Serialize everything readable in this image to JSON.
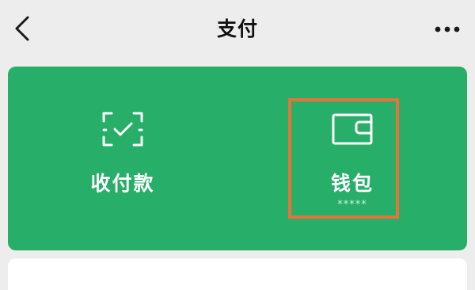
{
  "header": {
    "back_icon": "chevron-left-icon",
    "title": "支付",
    "more_icon": "more-dots-icon"
  },
  "pay_card": {
    "background_color": "#27ae69",
    "items": [
      {
        "label": "收付款",
        "icon": "scan-check-icon"
      },
      {
        "label": "钱包",
        "icon": "wallet-icon",
        "sub": "*****"
      }
    ]
  },
  "highlight_color": "#e8733a"
}
